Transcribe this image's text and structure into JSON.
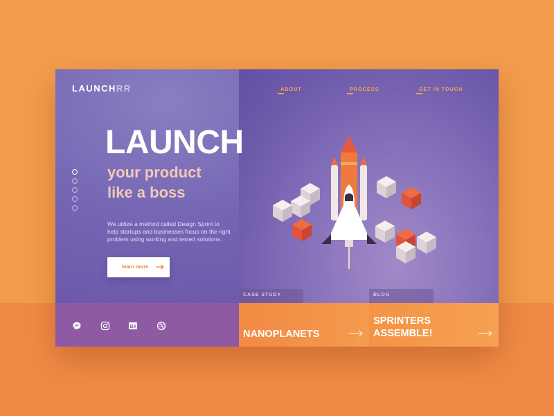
{
  "brand": {
    "logo_main": "LAUNCH",
    "logo_fade": "RR"
  },
  "nav": {
    "about": "ABOUT",
    "process": "PROCESS",
    "contact": "GET IN TOUCH"
  },
  "hero": {
    "title": "LAUNCH",
    "subtitle_line1": "your product",
    "subtitle_line2": "like a boss",
    "body": "We utilize a method called Design Sprint to help startups and businesses focus on the right problem using working and tested solutions.",
    "cta_label": "learn more"
  },
  "slider": {
    "count": 5,
    "active_index": 0
  },
  "tiles": [
    {
      "tag": "CASE STUDY",
      "title": "NANOPLANETS"
    },
    {
      "tag": "BLOG",
      "title_line1": "SPRINTERS",
      "title_line2": "ASSEMBLE!"
    }
  ],
  "social_icons": [
    "messenger-icon",
    "instagram-icon",
    "behance-icon",
    "dribbble-icon"
  ],
  "colors": {
    "page_bg": "#f29c4d",
    "card_purple": "#7565b4",
    "accent_orange": "#ef7a38",
    "footer_purple": "#8e5aa3"
  }
}
